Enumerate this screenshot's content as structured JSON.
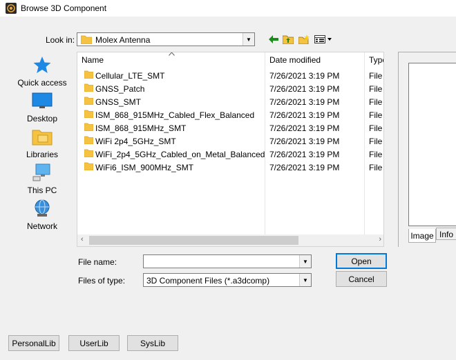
{
  "window": {
    "title": "Browse 3D Component"
  },
  "lookin": {
    "label": "Look in:",
    "value": "Molex Antenna"
  },
  "toolbar": [
    "back-icon",
    "up-folder-icon",
    "new-folder-icon",
    "view-menu-icon"
  ],
  "places": [
    {
      "label": "Quick access",
      "icon": "quick-access-icon"
    },
    {
      "label": "Desktop",
      "icon": "desktop-icon"
    },
    {
      "label": "Libraries",
      "icon": "libraries-icon"
    },
    {
      "label": "This PC",
      "icon": "this-pc-icon"
    },
    {
      "label": "Network",
      "icon": "network-icon"
    }
  ],
  "columns": {
    "name": "Name",
    "date": "Date modified",
    "type": "Type"
  },
  "files": [
    {
      "name": "Cellular_LTE_SMT",
      "date": "7/26/2021 3:19 PM",
      "type": "File fo"
    },
    {
      "name": "GNSS_Patch",
      "date": "7/26/2021 3:19 PM",
      "type": "File fo"
    },
    {
      "name": "GNSS_SMT",
      "date": "7/26/2021 3:19 PM",
      "type": "File fo"
    },
    {
      "name": "ISM_868_915MHz_Cabled_Flex_Balanced",
      "date": "7/26/2021 3:19 PM",
      "type": "File fo"
    },
    {
      "name": "ISM_868_915MHz_SMT",
      "date": "7/26/2021 3:19 PM",
      "type": "File fo"
    },
    {
      "name": "WiFi 2p4_5GHz_SMT",
      "date": "7/26/2021 3:19 PM",
      "type": "File fo"
    },
    {
      "name": "WiFi_2p4_5GHz_Cabled_on_Metal_Balanced",
      "date": "7/26/2021 3:19 PM",
      "type": "File fo"
    },
    {
      "name": "WiFi6_ISM_900MHz_SMT",
      "date": "7/26/2021 3:19 PM",
      "type": "File fo"
    }
  ],
  "preview": {
    "tab_image": "Image",
    "tab_info": "Info"
  },
  "filename": {
    "label": "File name:",
    "value": ""
  },
  "filetype": {
    "label": "Files of type:",
    "value": "3D Component Files (*.a3dcomp)"
  },
  "buttons": {
    "open": "Open",
    "cancel": "Cancel",
    "personal": "PersonalLib",
    "user": "UserLib",
    "sys": "SysLib"
  },
  "colors": {
    "folder": "#f5c242",
    "accent": "#0078d7"
  }
}
